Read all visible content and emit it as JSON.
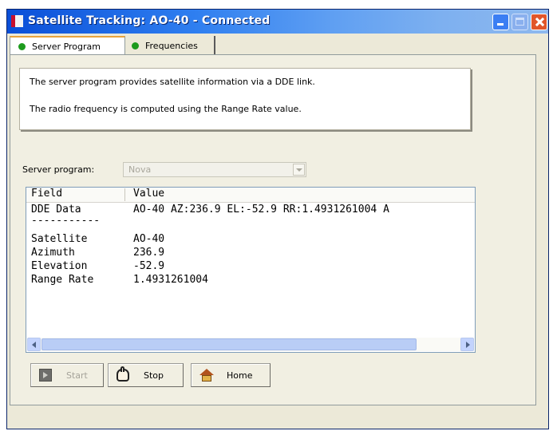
{
  "window": {
    "title": "Satellite Tracking: AO-40 - Connected"
  },
  "tabs": [
    {
      "label": "Server Program",
      "status_color": "#1d9b1d",
      "selected": true
    },
    {
      "label": "Frequencies",
      "status_color": "#1d9b1d",
      "selected": false
    }
  ],
  "info": {
    "line1": "The server program provides satellite information via a DDE link.",
    "line2": "The radio frequency is computed using the Range Rate value."
  },
  "server_program": {
    "label": "Server program:",
    "selected_value": "Nova",
    "enabled": false
  },
  "list": {
    "columns": [
      "Field",
      "Value"
    ],
    "rows": [
      {
        "field": "DDE Data",
        "value": "AO-40 AZ:236.9 EL:-52.9 RR:1.4931261004 A"
      },
      {
        "field": "-----------",
        "value": ""
      },
      {
        "field": "Satellite",
        "value": "AO-40"
      },
      {
        "field": "Azimuth",
        "value": "236.9"
      },
      {
        "field": "Elevation",
        "value": "-52.9"
      },
      {
        "field": "Range Rate",
        "value": "1.4931261004"
      }
    ]
  },
  "buttons": {
    "start": "Start",
    "stop": "Stop",
    "home": "Home"
  }
}
